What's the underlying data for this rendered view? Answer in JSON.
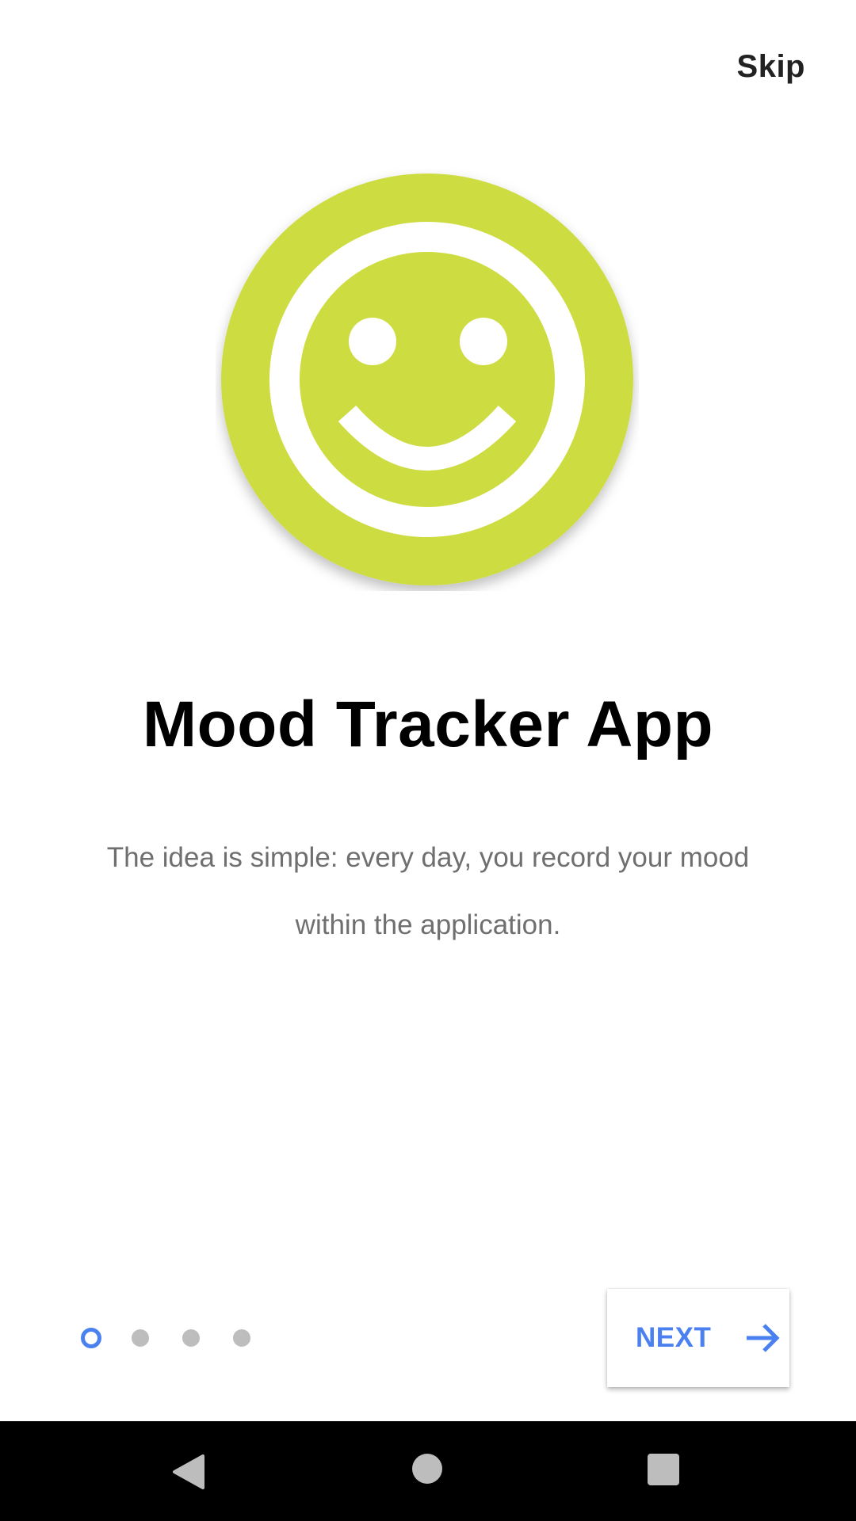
{
  "header": {
    "skip_label": "Skip"
  },
  "hero": {
    "icon": "smiley-face-icon",
    "background_color": "#cddc3f",
    "foreground_color": "#ffffff"
  },
  "content": {
    "title": "Mood Tracker App",
    "description": "The idea is simple: every day, you record your mood within the application."
  },
  "pager": {
    "total_pages": 4,
    "current_page": 1,
    "active_color": "#4a80f0",
    "inactive_color": "#bdbdbd"
  },
  "footer": {
    "next_label": "NEXT",
    "next_icon": "arrow-right-icon"
  },
  "navigation_bar": {
    "back_icon": "back-triangle-icon",
    "home_icon": "home-circle-icon",
    "recents_icon": "recents-square-icon"
  }
}
